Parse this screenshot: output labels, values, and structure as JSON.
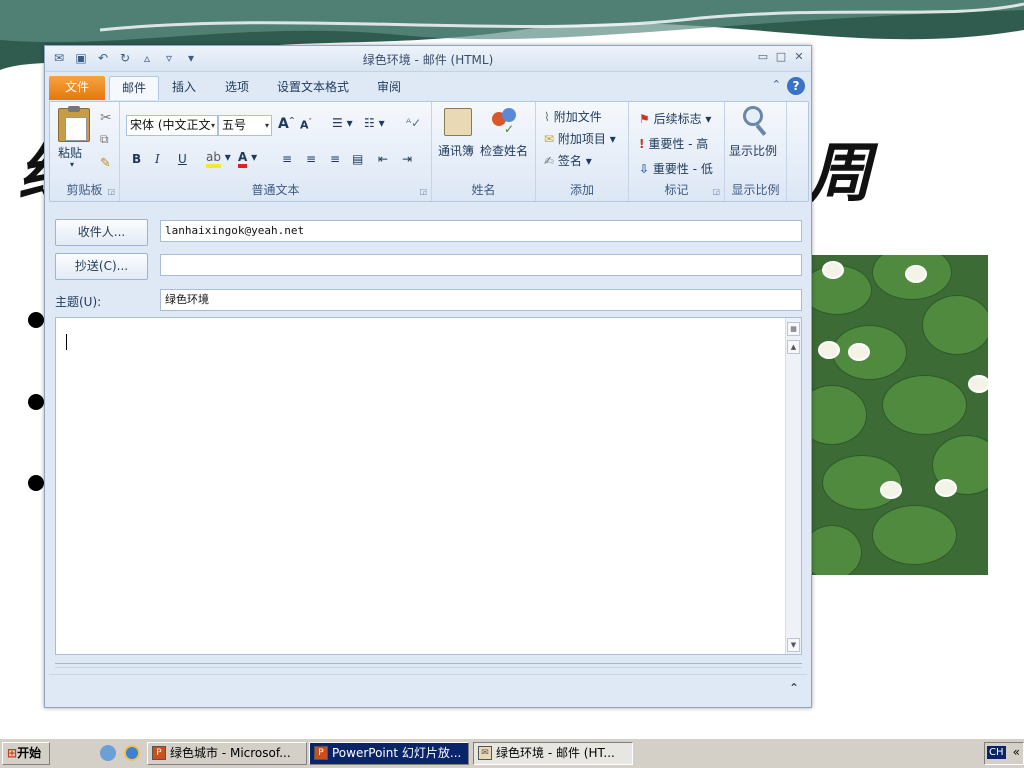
{
  "background": {
    "slide_title_left": "绿",
    "slide_title_right": "周"
  },
  "window": {
    "title": "绿色环境 - 邮件 (HTML)",
    "qat": [
      "save-icon",
      "undo-icon",
      "redo-icon",
      "up-icon",
      "down-icon",
      "customize-icon"
    ]
  },
  "tabs": {
    "file": "文件",
    "items": [
      "邮件",
      "插入",
      "选项",
      "设置文本格式",
      "审阅"
    ]
  },
  "ribbon": {
    "clipboard": {
      "paste": "粘贴",
      "label": "剪贴板"
    },
    "basic_text": {
      "font_name": "宋体 (中文正文",
      "font_size": "五号",
      "bold": "B",
      "italic": "I",
      "underline": "U",
      "label": "普通文本"
    },
    "names": {
      "address_book": "通讯簿",
      "check_names": "检查姓名",
      "label": "姓名"
    },
    "include": {
      "attach_file": "附加文件",
      "attach_item": "附加项目",
      "signature": "签名",
      "label": "添加"
    },
    "tags": {
      "follow_up": "后续标志",
      "high": "重要性 - 高",
      "low": "重要性 - 低",
      "label": "标记"
    },
    "zoom": {
      "zoom": "显示比例",
      "label": "显示比例"
    }
  },
  "compose": {
    "to_button": "收件人...",
    "to_value": "lanhaixingok@yeah.net",
    "cc_button": "抄送(C)...",
    "cc_value": "",
    "subject_label": "主题(U):",
    "subject_value": "绿色环境"
  },
  "taskbar": {
    "start": "开始",
    "tasks": [
      "绿色城市 - Microsof...",
      "PowerPoint 幻灯片放...",
      "绿色环境 - 邮件 (HT..."
    ],
    "lang": "CH",
    "tray_arrow": "«"
  },
  "colors": {
    "file_tab": "#e4780d",
    "ribbon_bg": "#dce7f5",
    "taskbar": "#d4d0c8"
  }
}
